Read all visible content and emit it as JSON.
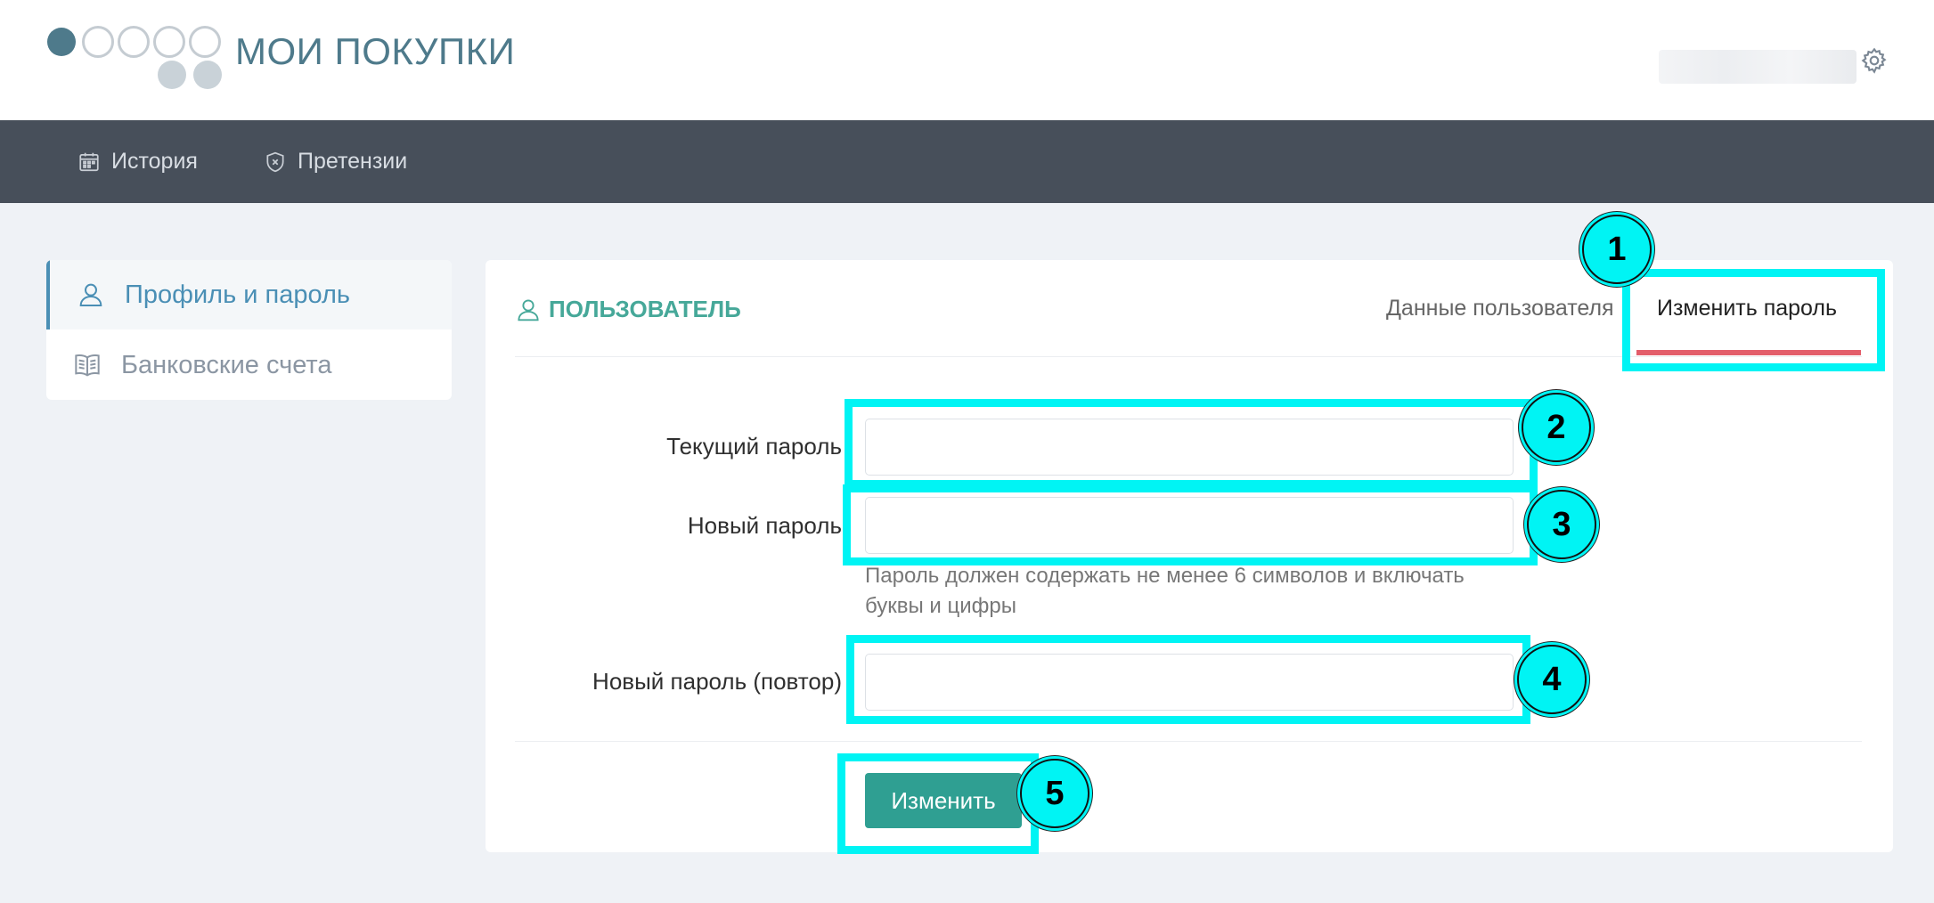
{
  "header": {
    "app_title": "МОИ ПОКУПКИ",
    "logo_icon": "circles-logo-icon",
    "settings_icon": "gear-icon",
    "brand_color": "#4e7a8b"
  },
  "nav": {
    "items": [
      {
        "label": "История",
        "icon": "calendar-icon"
      },
      {
        "label": "Претензии",
        "icon": "shield-icon"
      }
    ],
    "background": "#474f5a"
  },
  "sidebar": {
    "items": [
      {
        "label": "Профиль и пароль",
        "icon": "user-icon",
        "active": true
      },
      {
        "label": "Банковские счета",
        "icon": "book-icon",
        "active": false
      }
    ]
  },
  "card": {
    "title": "ПОЛЬЗОВАТЕЛЬ",
    "title_icon": "user-icon",
    "tabs": [
      {
        "label": "Данные пользователя",
        "active": false
      },
      {
        "label": "Изменить пароль",
        "active": true
      }
    ],
    "form": {
      "current_password_label": "Текущий пароль",
      "current_password_value": "",
      "new_password_label": "Новый пароль",
      "new_password_value": "",
      "password_hint": "Пароль должен содержать не менее 6 символов и включать буквы и цифры",
      "repeat_password_label": "Новый пароль (повтор)",
      "repeat_password_value": "",
      "submit_label": "Изменить"
    },
    "accent_color": "#2f9f92",
    "tab_underline_color": "#e35d6a"
  },
  "annotations": {
    "badges": [
      "1",
      "2",
      "3",
      "4",
      "5"
    ],
    "highlight_color": "#00f4f4"
  }
}
